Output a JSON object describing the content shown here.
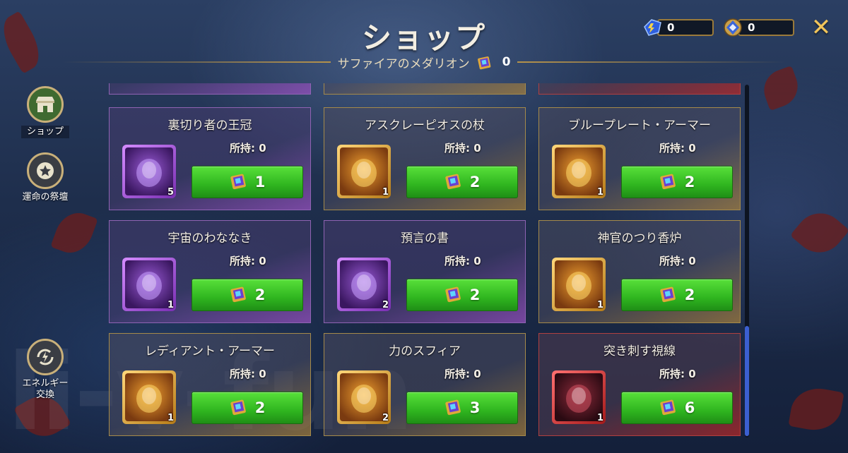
{
  "header": {
    "title": "ショップ",
    "subtitle": "サファイアのメダリオン",
    "medallion_count": "0"
  },
  "currency": {
    "energy": "0",
    "emblem": "0"
  },
  "sidebar": {
    "items": [
      {
        "label": "ショップ",
        "active": true
      },
      {
        "label": "運命の祭壇",
        "active": false
      },
      {
        "label": "エネルギー\n交換",
        "active": false
      }
    ]
  },
  "shop": {
    "owned_prefix": "所持: ",
    "items": [
      {
        "name": "裏切り者の王冠",
        "owned": "所持: 0",
        "qty": "5",
        "price": "1",
        "rarity": "purple"
      },
      {
        "name": "アスクレーピオスの杖",
        "owned": "所持: 0",
        "qty": "1",
        "price": "2",
        "rarity": "gold"
      },
      {
        "name": "ブループレート・アーマー",
        "owned": "所持: 0",
        "qty": "1",
        "price": "2",
        "rarity": "gold"
      },
      {
        "name": "宇宙のわななき",
        "owned": "所持: 0",
        "qty": "1",
        "price": "2",
        "rarity": "purple"
      },
      {
        "name": "預言の書",
        "owned": "所持: 0",
        "qty": "2",
        "price": "2",
        "rarity": "purple"
      },
      {
        "name": "神官のつり香炉",
        "owned": "所持: 0",
        "qty": "1",
        "price": "2",
        "rarity": "gold"
      },
      {
        "name": "レディアント・アーマー",
        "owned": "所持: 0",
        "qty": "1",
        "price": "2",
        "rarity": "gold"
      },
      {
        "name": "力のスフィア",
        "owned": "所持: 0",
        "qty": "2",
        "price": "3",
        "rarity": "gold"
      },
      {
        "name": "突き刺す視線",
        "owned": "所持: 0",
        "qty": "1",
        "price": "6",
        "rarity": "red"
      }
    ]
  },
  "colors": {
    "buy_button": "#2fb51f",
    "epic": "#8f63b3",
    "legendary": "#a58a4a",
    "mythic": "#b04040",
    "title": "#f3eee2",
    "close": "#f0c45a"
  }
}
